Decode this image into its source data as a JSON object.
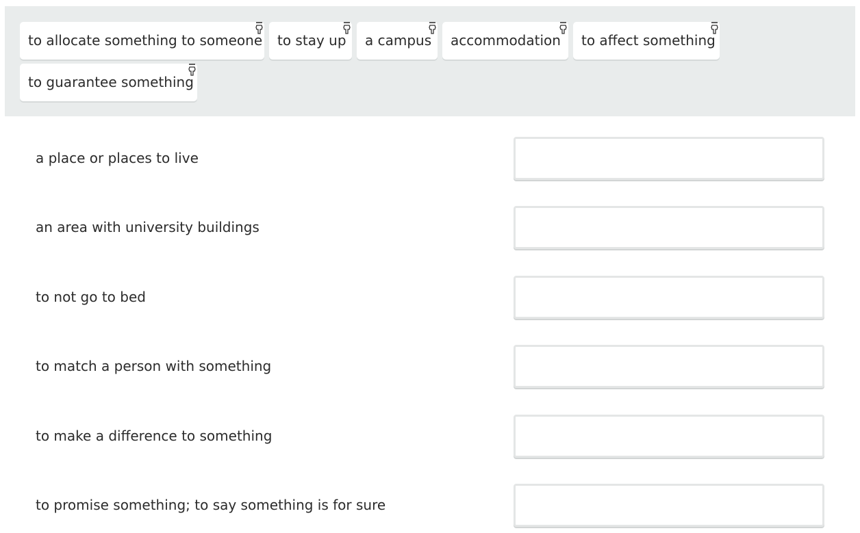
{
  "chips": [
    {
      "label": "to allocate something to someone",
      "icon": "drag-hand-icon"
    },
    {
      "label": "to stay up",
      "icon": "drag-hand-icon"
    },
    {
      "label": "a campus",
      "icon": "drag-hand-icon"
    },
    {
      "label": "accommodation",
      "icon": "drag-hand-icon"
    },
    {
      "label": "to affect something",
      "icon": "drag-hand-icon"
    },
    {
      "label": "to guarantee something",
      "icon": "drag-hand-icon"
    }
  ],
  "definitions": [
    {
      "text": "a place or places to live",
      "answer": ""
    },
    {
      "text": "an area with university buildings",
      "answer": ""
    },
    {
      "text": "to not go to bed",
      "answer": ""
    },
    {
      "text": "to match a person with something",
      "answer": ""
    },
    {
      "text": "to make a difference to something",
      "answer": ""
    },
    {
      "text": "to promise something; to say something is for sure",
      "answer": ""
    }
  ],
  "colors": {
    "pool_background": "#e9ecec",
    "chip_background": "#ffffff",
    "drop_border": "#e4e6e6",
    "text": "#2b2b2b"
  }
}
